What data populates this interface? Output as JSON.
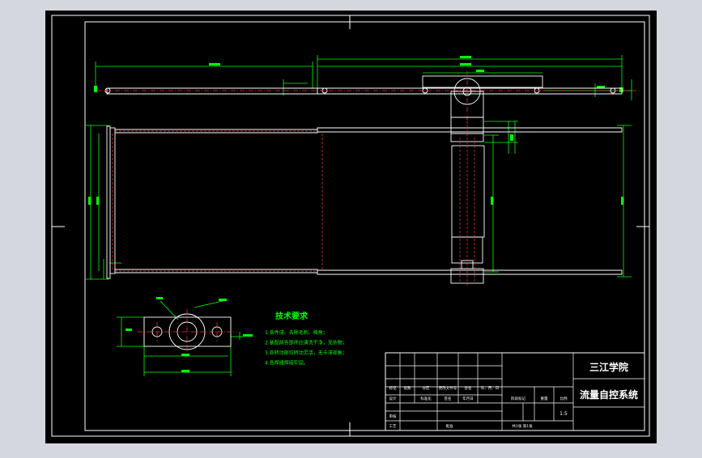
{
  "technical_requirements": {
    "title": "技术要求",
    "items": [
      "1.各件成、去除毛刺、棱角；",
      "2.装配前各部件应清洗干净，无杂物；",
      "3.各转动部位转动灵活，无卡滞现象；",
      "4.各焊缝焊接牢固。"
    ]
  },
  "title_block": {
    "school": "三江学院",
    "drawing_title": "流量自控系统",
    "scale": "1:5",
    "row_labels": [
      "标记",
      "设计",
      "审核",
      "工艺"
    ],
    "header_labels": [
      "处数",
      "分区",
      "更改文件号",
      "签名",
      "年、月、日"
    ],
    "design_row": [
      "标准化",
      "签名",
      "年月日"
    ],
    "stage_labels": [
      "阶段标记",
      "重量",
      "比例"
    ],
    "approve_label": "批准",
    "sheet_label": "共1张  第1张"
  },
  "colors": {
    "background": "#000000",
    "outer_frame": "#ffffff",
    "title_block_lines": "#ffffff",
    "part_outline": "#ffffff",
    "dimension": "#00ff00",
    "center_line": "#ff3333",
    "hidden_line": "#ff3333",
    "text": "#ffffff",
    "requirements_text": "#00ff00"
  }
}
